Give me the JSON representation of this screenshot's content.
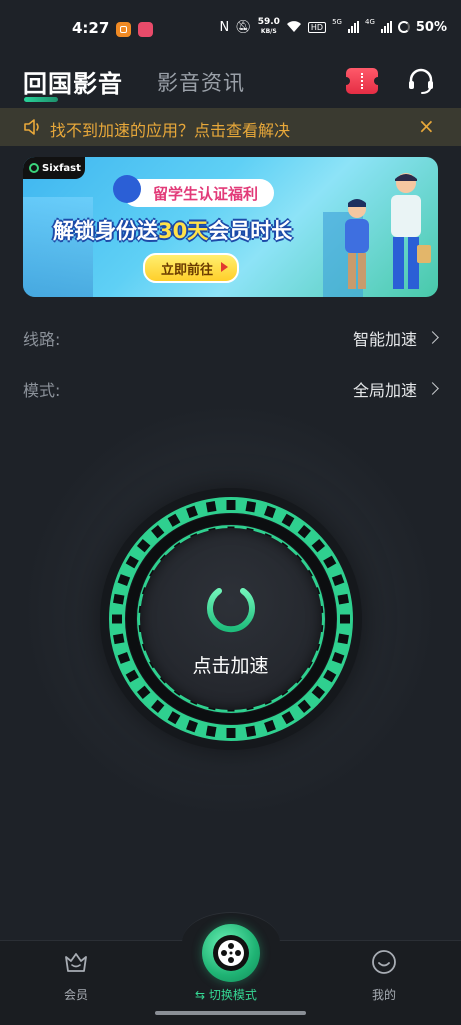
{
  "status_bar": {
    "time": "4:27",
    "speed_value": "59.0",
    "speed_unit": "KB/S",
    "hd": "HD",
    "net1": "5G",
    "net2": "4G",
    "battery": "50%"
  },
  "header": {
    "active_tab": "回国影音",
    "inactive_tab": "影音资讯"
  },
  "notice": {
    "text": "找不到加速的应用？点击查看解决",
    "close": "×"
  },
  "banner": {
    "logo_text": "Sixfast",
    "tag": "留学生认证福利",
    "headline_pre": "解锁身份送",
    "headline_hl": "30天",
    "headline_post": "会员时长",
    "button": "立即前往"
  },
  "options": {
    "route_label": "线路:",
    "route_value": "智能加速",
    "mode_label": "模式:",
    "mode_value": "全局加速"
  },
  "power": {
    "label": "点击加速"
  },
  "bottom_nav": {
    "member_label": "会员",
    "switch_label": "⇆ 切换模式",
    "mine_label": "我的"
  },
  "colors": {
    "accent": "#2fd08f",
    "notice_text": "#e8a83a",
    "background": "#1e2228"
  }
}
